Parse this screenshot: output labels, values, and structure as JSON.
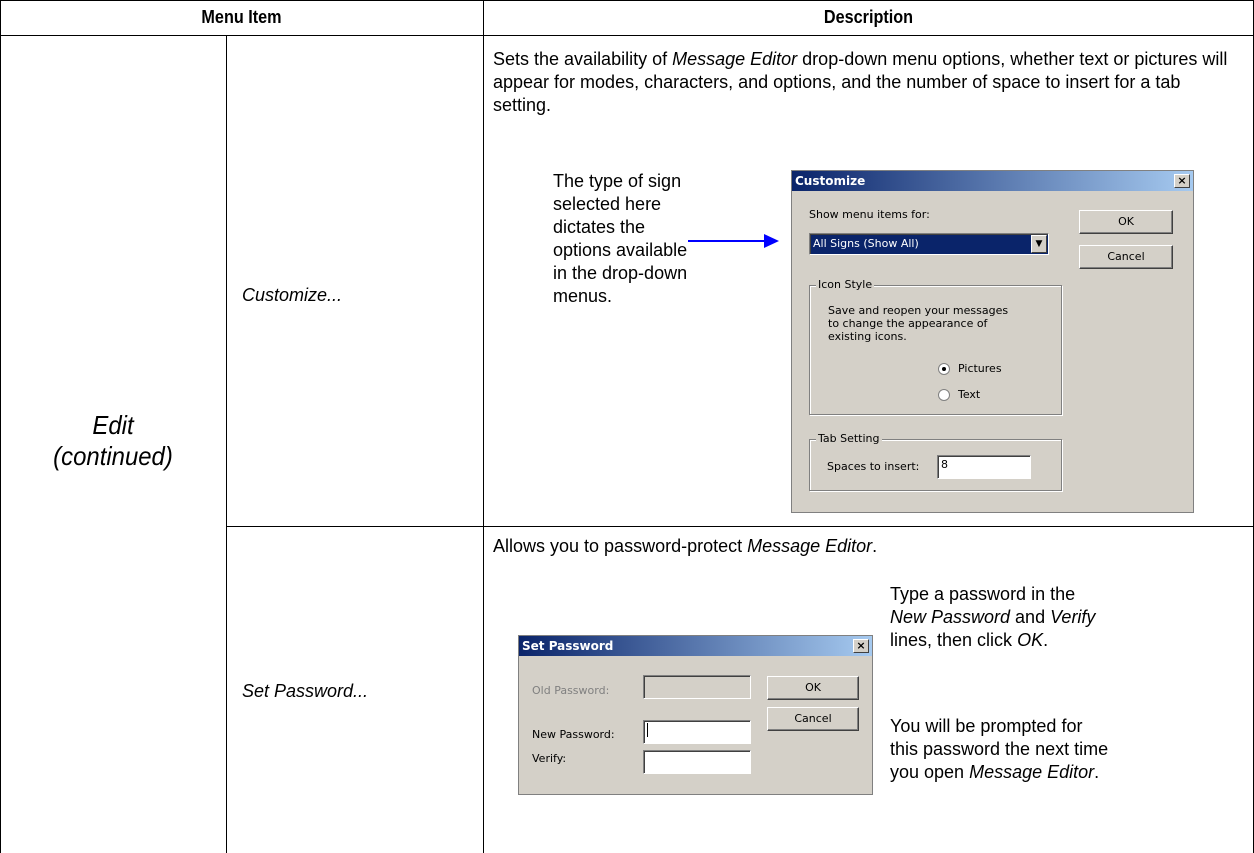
{
  "table": {
    "header_menu": "Menu Item",
    "header_desc": "Description",
    "group_label_line1": "Edit",
    "group_label_line2": "(continued)"
  },
  "rows": [
    {
      "item": "Customize...",
      "desc_pre": "Sets the availability of ",
      "desc_em": "Message Editor",
      "desc_post": " drop-down menu options, whether text or pictures will appear for modes, characters, and options, and the number of space to insert for a tab setting.",
      "callout": [
        "The type of sign",
        "selected here",
        "dictates the",
        "options available",
        "in the drop-down",
        "menus."
      ]
    },
    {
      "item": "Set Password...",
      "desc_pre": "Allows you to password-protect ",
      "desc_em": "Message Editor",
      "desc_post": ".",
      "note1_a": "Type a password in the ",
      "note1_b": "New Password",
      "note1_c": " and ",
      "note1_d": "Verify",
      "note1_e": " lines, then click ",
      "note1_f": "OK",
      "note1_g": ".",
      "note2_a": "You will be prompted for this password the next time you open ",
      "note2_b": "Message Editor",
      "note2_c": "."
    }
  ],
  "customize_dialog": {
    "title": "Customize",
    "close": "×",
    "show_label": "Show menu items for:",
    "select_value": "All Signs (Show All)",
    "ok": "OK",
    "cancel": "Cancel",
    "icon_group": "Icon Style",
    "icon_note": "Save and reopen your messages to change the appearance of existing icons.",
    "radio_pictures": "Pictures",
    "radio_text": "Text",
    "pictures_selected": true,
    "tab_group": "Tab Setting",
    "spaces_label": "Spaces to insert:",
    "spaces_value": "8"
  },
  "password_dialog": {
    "title": "Set Password",
    "close": "×",
    "old_label": "Old Password:",
    "new_label": "New Password:",
    "verify_label": "Verify:",
    "ok": "OK",
    "cancel": "Cancel"
  },
  "colors": {
    "arrow": "#0000ff",
    "titlebar_start": "#0a246a",
    "titlebar_end": "#a6caf0",
    "dialog_face": "#d4d0c8"
  }
}
